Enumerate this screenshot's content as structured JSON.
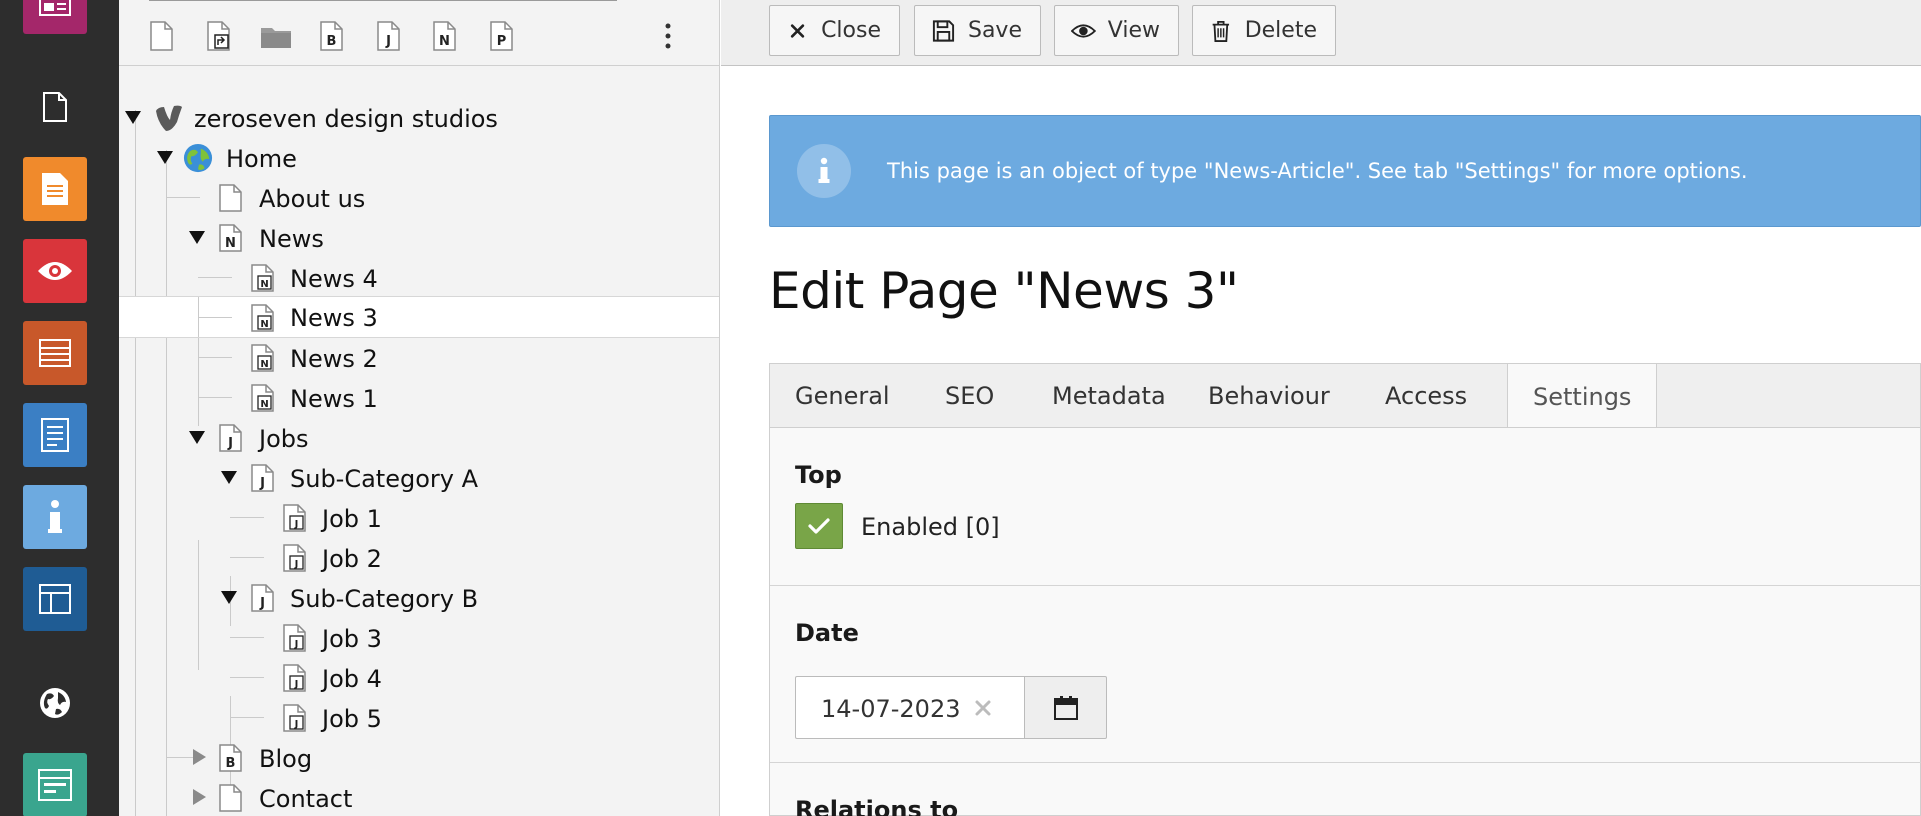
{
  "modules": [
    {
      "name": "web-layout-icon",
      "color": "#a4276a"
    },
    {
      "name": "page-icon",
      "color": "#2d2d2d"
    },
    {
      "name": "list-icon",
      "color": "#f08a2c"
    },
    {
      "name": "view-eye-icon",
      "color": "#d9353b"
    },
    {
      "name": "list-rows-icon",
      "color": "#c8582a"
    },
    {
      "name": "document-icon",
      "color": "#3b7fc4"
    },
    {
      "name": "info-icon",
      "color": "#6daae0"
    },
    {
      "name": "template-icon",
      "color": "#1f5c94"
    },
    {
      "name": "globe-icon",
      "color": "#2d2d2d"
    },
    {
      "name": "form-icon",
      "color": "#3aa58e"
    }
  ],
  "tree_toolbar": {
    "doctypes": [
      "",
      "",
      "",
      "B",
      "J",
      "N",
      "P"
    ]
  },
  "tree": {
    "root": "zeroseven design studios",
    "home": "Home",
    "about": "About us",
    "news": "News",
    "news4": "News 4",
    "news3": "News 3",
    "news2": "News 2",
    "news1": "News 1",
    "jobs": "Jobs",
    "subA": "Sub-Category A",
    "job1": "Job 1",
    "job2": "Job 2",
    "subB": "Sub-Category B",
    "job3": "Job 3",
    "job4": "Job 4",
    "job5": "Job 5",
    "blog": "Blog",
    "contact": "Contact",
    "badges": {
      "news": "N",
      "jobs": "J",
      "blog": "B"
    }
  },
  "toolbar": {
    "close": "Close",
    "save": "Save",
    "view": "View",
    "delete": "Delete"
  },
  "callout": {
    "text": "This page is an object of type \"News-Article\". See tab \"Settings\" for more options."
  },
  "page_title": "Edit Page \"News 3\"",
  "tabs": [
    "General",
    "SEO",
    "Metadata",
    "Behaviour",
    "Access",
    "Settings"
  ],
  "active_tab": "Settings",
  "settings": {
    "top_label": "Top",
    "top_enabled_label": "Enabled [0]",
    "top_checked": true,
    "date_label": "Date",
    "date_value": "14-07-2023",
    "relations_label": "Relations to"
  }
}
